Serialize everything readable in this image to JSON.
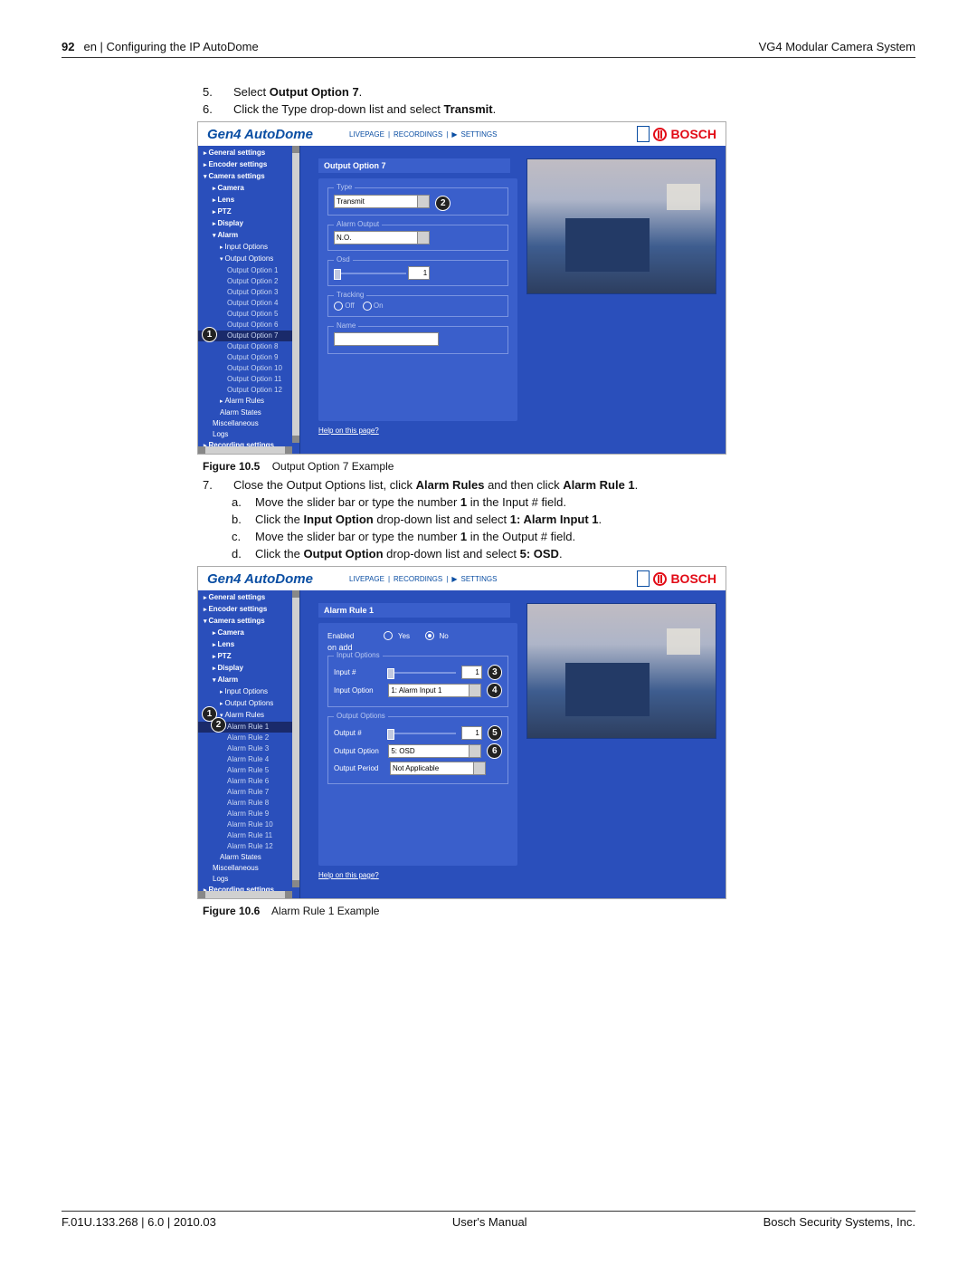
{
  "header": {
    "page_number": "92",
    "section": "en | Configuring the IP AutoDome",
    "product": "VG4 Modular Camera System"
  },
  "footer": {
    "docref": "F.01U.133.268 | 6.0 | 2010.03",
    "center": "User's Manual",
    "right": "Bosch Security Systems, Inc."
  },
  "step5": {
    "num": "5.",
    "pre": "Select ",
    "bold": "Output Option 7",
    "post": "."
  },
  "step6": {
    "num": "6.",
    "pre": "Click the Type drop-down list and select ",
    "bold": "Transmit",
    "post": "."
  },
  "step7": {
    "num": "7.",
    "pre1": "Close the Output Options list, click ",
    "bold1": "Alarm Rules",
    "mid1": " and then click ",
    "bold2": "Alarm Rule 1",
    "post1": "."
  },
  "sub_a": {
    "lbl": "a.",
    "pre": "Move the slider bar or type the number ",
    "bold": "1",
    "post": " in the Input # field."
  },
  "sub_b": {
    "lbl": "b.",
    "pre": "Click the ",
    "bold1": "Input Option",
    "mid": " drop-down list and select ",
    "bold2": "1: Alarm Input 1",
    "post": "."
  },
  "sub_c": {
    "lbl": "c.",
    "pre": "Move the slider bar or type the number ",
    "bold": "1",
    "post": " in the Output # field."
  },
  "sub_d": {
    "lbl": "d.",
    "pre": "Click the ",
    "bold1": "Output Option",
    "mid": " drop-down list and select ",
    "bold2": "5: OSD",
    "post": "."
  },
  "fig105": {
    "label": "Figure 10.5",
    "caption": "Output Option 7 Example"
  },
  "fig106": {
    "label": "Figure 10.6",
    "caption": "Alarm Rule 1 Example"
  },
  "gui": {
    "title": "Gen4 AutoDome",
    "tabs": {
      "live": "LIVEPAGE",
      "rec": "RECORDINGS",
      "set": "SETTINGS"
    },
    "brand": "BOSCH",
    "sidebar": {
      "general": "General settings",
      "encoder": "Encoder settings",
      "camera": "Camera settings",
      "cam": "Camera",
      "lens": "Lens",
      "ptz": "PTZ",
      "display": "Display",
      "alarm": "Alarm",
      "input_opts": "Input Options",
      "output_opts": "Output Options",
      "out1": "Output Option 1",
      "out2": "Output Option 2",
      "out3": "Output Option 3",
      "out4": "Output Option 4",
      "out5": "Output Option 5",
      "out6": "Output Option 6",
      "out7": "Output Option 7",
      "out8": "Output Option 8",
      "out9": "Output Option 9",
      "out10": "Output Option 10",
      "out11": "Output Option 11",
      "out12": "Output Option 12",
      "alarm_rules": "Alarm Rules",
      "rule1": "Alarm Rule 1",
      "rule2": "Alarm Rule 2",
      "rule3": "Alarm Rule 3",
      "rule4": "Alarm Rule 4",
      "rule5": "Alarm Rule 5",
      "rule6": "Alarm Rule 6",
      "rule7": "Alarm Rule 7",
      "rule8": "Alarm Rule 8",
      "rule9": "Alarm Rule 9",
      "rule10": "Alarm Rule 10",
      "rule11": "Alarm Rule 11",
      "rule12": "Alarm Rule 12",
      "alarm_states": "Alarm States",
      "misc": "Miscellaneous",
      "logs": "Logs",
      "recording": "Recording settings"
    },
    "panel1": {
      "title": "Output Option 7",
      "type_legend": "Type",
      "type_value": "Transmit",
      "alarm_output_legend": "Alarm Output",
      "alarm_output_value": "N.O.",
      "osd_legend": "Osd",
      "osd_value": "1",
      "tracking_legend": "Tracking",
      "tracking_off": "Off",
      "tracking_on": "On",
      "name_legend": "Name",
      "name_value": ""
    },
    "panel2": {
      "title": "Alarm Rule 1",
      "enabled_label": "Enabled",
      "yes": "Yes",
      "no": "No",
      "input_options_legend": "Input Options",
      "input_num_label": "Input #",
      "input_num_value": "1",
      "input_option_label": "Input Option",
      "input_option_value": "1: Alarm Input 1",
      "output_options_legend": "Output Options",
      "output_num_label": "Output #",
      "output_num_value": "1",
      "output_option_label": "Output Option",
      "output_option_value": "5: OSD",
      "output_period_label": "Output Period",
      "output_period_value": "Not Applicable"
    },
    "help": "Help on this page?"
  },
  "callouts": {
    "c1": "1",
    "c2": "2",
    "c3": "3",
    "c4": "4",
    "c5": "5",
    "c6": "6"
  }
}
